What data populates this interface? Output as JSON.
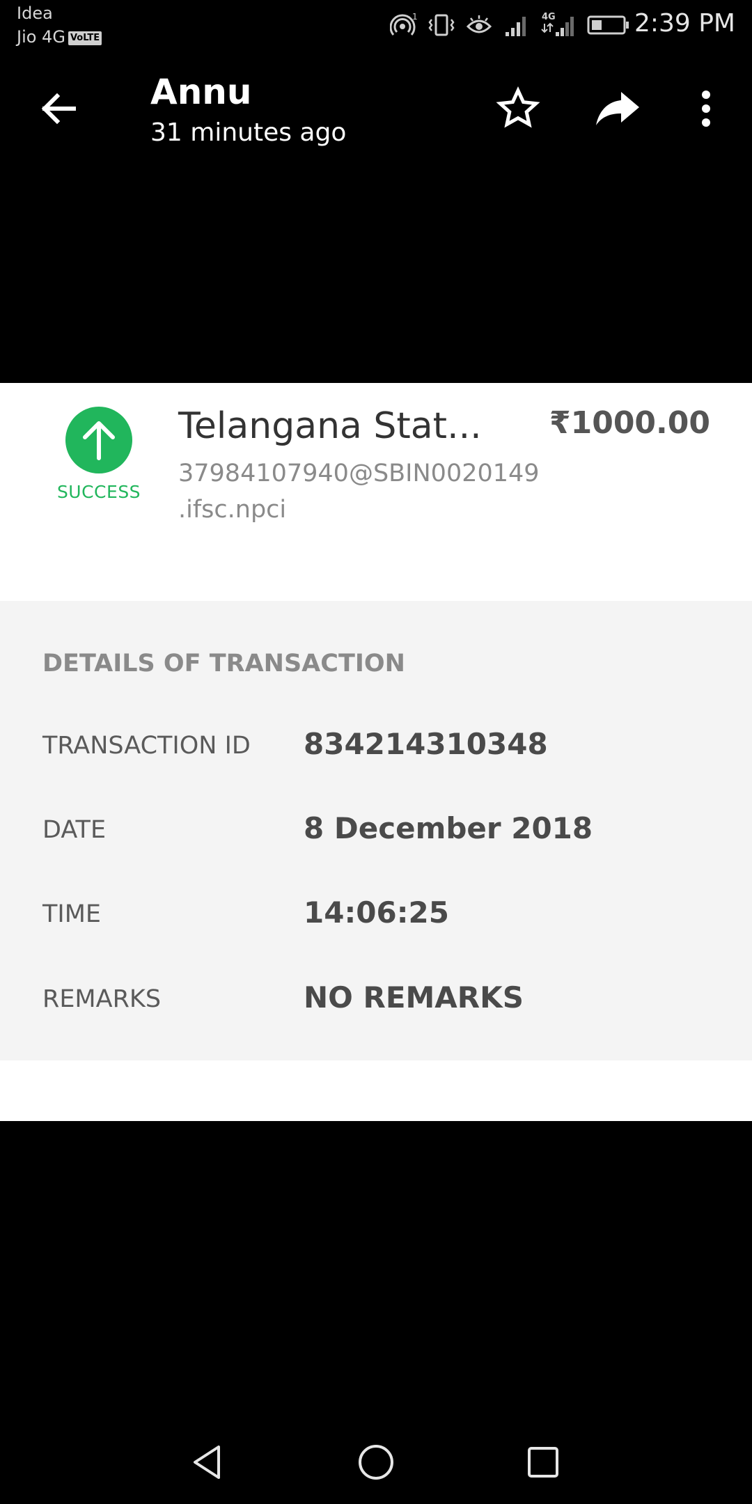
{
  "status_bar": {
    "carrier_1": "Idea",
    "carrier_2": "Jio 4G",
    "volte_badge": "VoLTE",
    "network_label": "4G",
    "time": "2:39 PM"
  },
  "toolbar": {
    "title": "Annu",
    "subtitle": "31 minutes ago",
    "icons": [
      "arrow-back-icon",
      "star-outline-icon",
      "share-icon",
      "more-vert-icon"
    ]
  },
  "transaction": {
    "status": "SUCCESS",
    "status_color": "#21b65c",
    "payee_name": "Telangana Stat...",
    "payee_upi": "37984107940@SBIN0020149 .ifsc.npci",
    "amount": "₹1000.00"
  },
  "details": {
    "heading": "DETAILS OF TRANSACTION",
    "rows": [
      {
        "label": "TRANSACTION ID",
        "value": "834214310348"
      },
      {
        "label": "DATE",
        "value": "8 December 2018"
      },
      {
        "label": "TIME",
        "value": "14:06:25"
      },
      {
        "label": "REMARKS",
        "value": "NO REMARKS"
      }
    ]
  },
  "nav_bar": {
    "icons": [
      "nav-back-icon",
      "nav-home-icon",
      "nav-recents-icon"
    ]
  }
}
